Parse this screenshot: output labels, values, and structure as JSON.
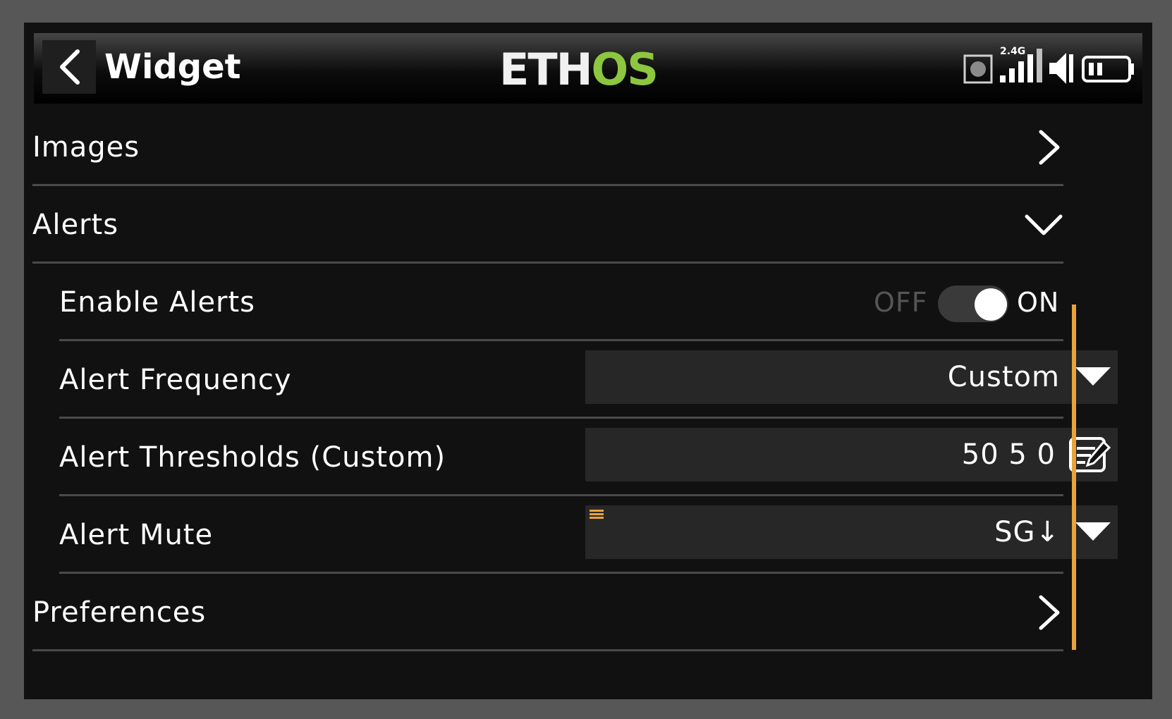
{
  "header": {
    "title": "Widget",
    "logo_white": "ETH",
    "logo_green": "OS",
    "rf_band": "2.4G",
    "back_icon": "chevron-left-icon"
  },
  "colors": {
    "accent_green": "#8dc63f",
    "scroll_orange": "#e8a33c",
    "background": "#111111",
    "field_bg": "#272727"
  },
  "sections": {
    "images": {
      "label": "Images"
    },
    "alerts": {
      "label": "Alerts"
    },
    "preferences": {
      "label": "Preferences"
    }
  },
  "alerts": {
    "enable": {
      "label": "Enable Alerts",
      "off_label": "OFF",
      "on_label": "ON",
      "state": "ON"
    },
    "frequency": {
      "label": "Alert Frequency",
      "value": "Custom"
    },
    "thresholds": {
      "label": "Alert Thresholds (Custom)",
      "value": "50 5 0"
    },
    "mute": {
      "label": "Alert Mute",
      "value": "SG↓"
    }
  }
}
